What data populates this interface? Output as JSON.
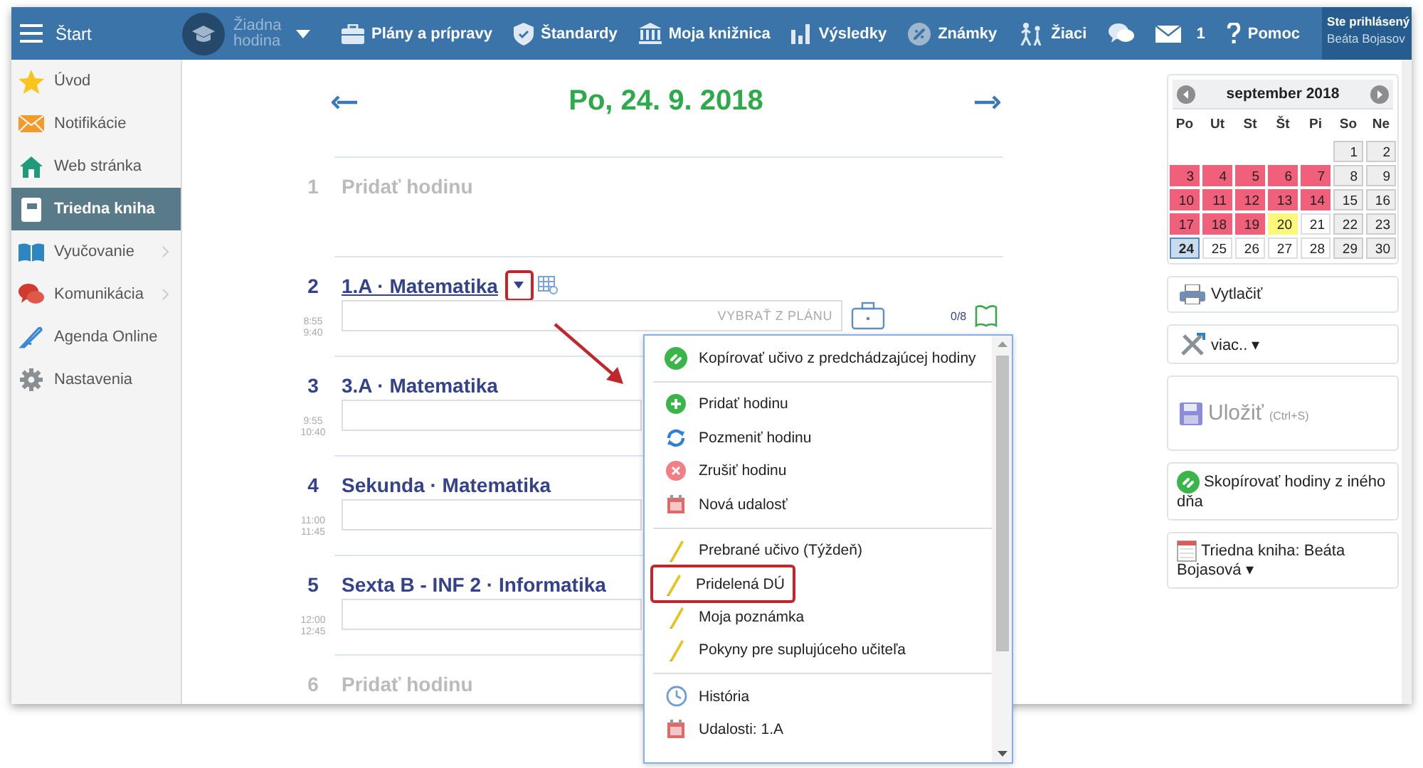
{
  "topbar": {
    "start": "Štart",
    "lesson_selector": "Žiadna hodina",
    "nav": [
      "Plány a prípravy",
      "Štandardy",
      "Moja knižnica",
      "Výsledky",
      "Známky",
      "Žiaci"
    ],
    "message_count": "1",
    "help": "Pomoc",
    "user": {
      "caption": "Ste prihlásený",
      "name": "Beáta Bojasov"
    }
  },
  "sidebar": {
    "items": [
      {
        "label": "Úvod",
        "selected": false,
        "has_submenu": false
      },
      {
        "label": "Notifikácie",
        "selected": false,
        "has_submenu": false
      },
      {
        "label": "Web stránka",
        "selected": false,
        "has_submenu": false
      },
      {
        "label": "Triedna kniha",
        "selected": true,
        "has_submenu": false
      },
      {
        "label": "Vyučovanie",
        "selected": false,
        "has_submenu": true
      },
      {
        "label": "Komunikácia",
        "selected": false,
        "has_submenu": true
      },
      {
        "label": "Agenda Online",
        "selected": false,
        "has_submenu": false
      },
      {
        "label": "Nastavenia",
        "selected": false,
        "has_submenu": false
      }
    ]
  },
  "day": {
    "title": "Po, 24. 9. 2018",
    "lessons": [
      {
        "kind": "empty",
        "number": "1",
        "title": "Pridať hodinu"
      },
      {
        "kind": "lesson",
        "number": "2",
        "title": "1.A · Matematika",
        "start": "8:55",
        "end": "9:40",
        "hovered": true,
        "annotated": true,
        "plan_button": "VYBRAŤ Z PLÁNU",
        "count": "0/8"
      },
      {
        "kind": "lesson",
        "number": "3",
        "title": "3.A · Matematika",
        "start": "9:55",
        "end": "10:40",
        "hovered": false
      },
      {
        "kind": "lesson",
        "number": "4",
        "title": "Sekunda · Matematika",
        "start": "11:00",
        "end": "11:45",
        "hovered": false
      },
      {
        "kind": "lesson",
        "number": "5",
        "title": "Sexta B - INF 2 · Informatika",
        "start": "12:00",
        "end": "12:45",
        "hovered": false
      },
      {
        "kind": "empty",
        "number": "6",
        "title": "Pridať hodinu"
      }
    ]
  },
  "context_menu": {
    "groups": [
      [
        {
          "label": "Kopírovať učivo z predchádzajúcej hodiny",
          "annotated": false
        }
      ],
      [
        {
          "label": "Pridať hodinu",
          "annotated": false
        },
        {
          "label": "Pozmeniť hodinu",
          "annotated": false
        },
        {
          "label": "Zrušiť hodinu",
          "annotated": false
        },
        {
          "label": "Nová udalosť",
          "annotated": false
        }
      ],
      [
        {
          "label": "Prebrané učivo (Týždeň)",
          "annotated": false
        },
        {
          "label": "Pridelená DÚ",
          "annotated": true
        },
        {
          "label": "Moja poznámka",
          "annotated": false
        },
        {
          "label": "Pokyny pre suplujúceho učiteľa",
          "annotated": false
        }
      ],
      [
        {
          "label": "História",
          "annotated": false
        },
        {
          "label": "Udalosti: 1.A",
          "annotated": false
        }
      ]
    ]
  },
  "calendar": {
    "title": "september 2018",
    "weekdays": [
      "Po",
      "Ut",
      "St",
      "Št",
      "Pi",
      "So",
      "Ne"
    ],
    "weeks": [
      [
        {
          "kind": "blank"
        },
        {
          "kind": "blank"
        },
        {
          "kind": "blank"
        },
        {
          "kind": "blank"
        },
        {
          "kind": "blank"
        },
        {
          "kind": "day",
          "day": "1",
          "color": "#eeeeee",
          "selected": false
        },
        {
          "kind": "day",
          "day": "2",
          "color": "#eeeeee",
          "selected": false
        }
      ],
      [
        {
          "kind": "day",
          "day": "3",
          "color": "#f0607a",
          "selected": false
        },
        {
          "kind": "day",
          "day": "4",
          "color": "#f0607a",
          "selected": false
        },
        {
          "kind": "day",
          "day": "5",
          "color": "#f0607a",
          "selected": false
        },
        {
          "kind": "day",
          "day": "6",
          "color": "#f0607a",
          "selected": false
        },
        {
          "kind": "day",
          "day": "7",
          "color": "#f0607a",
          "selected": false
        },
        {
          "kind": "day",
          "day": "8",
          "color": "#eeeeee",
          "selected": false
        },
        {
          "kind": "day",
          "day": "9",
          "color": "#eeeeee",
          "selected": false
        }
      ],
      [
        {
          "kind": "day",
          "day": "10",
          "color": "#f0607a",
          "selected": false
        },
        {
          "kind": "day",
          "day": "11",
          "color": "#f0607a",
          "selected": false
        },
        {
          "kind": "day",
          "day": "12",
          "color": "#f0607a",
          "selected": false
        },
        {
          "kind": "day",
          "day": "13",
          "color": "#f0607a",
          "selected": false
        },
        {
          "kind": "day",
          "day": "14",
          "color": "#f0607a",
          "selected": false
        },
        {
          "kind": "day",
          "day": "15",
          "color": "#eeeeee",
          "selected": false
        },
        {
          "kind": "day",
          "day": "16",
          "color": "#eeeeee",
          "selected": false
        }
      ],
      [
        {
          "kind": "day",
          "day": "17",
          "color": "#f0607a",
          "selected": false
        },
        {
          "kind": "day",
          "day": "18",
          "color": "#f0607a",
          "selected": false
        },
        {
          "kind": "day",
          "day": "19",
          "color": "#f0607a",
          "selected": false
        },
        {
          "kind": "day",
          "day": "20",
          "color": "#fdf77a",
          "selected": false
        },
        {
          "kind": "day",
          "day": "21",
          "color": "#ffffff",
          "selected": false
        },
        {
          "kind": "day",
          "day": "22",
          "color": "#eeeeee",
          "selected": false
        },
        {
          "kind": "day",
          "day": "23",
          "color": "#eeeeee",
          "selected": false
        }
      ],
      [
        {
          "kind": "day",
          "day": "24",
          "color": "#c9dbee",
          "selected": true
        },
        {
          "kind": "day",
          "day": "25",
          "color": "#ffffff",
          "selected": false
        },
        {
          "kind": "day",
          "day": "26",
          "color": "#ffffff",
          "selected": false
        },
        {
          "kind": "day",
          "day": "27",
          "color": "#ffffff",
          "selected": false
        },
        {
          "kind": "day",
          "day": "28",
          "color": "#ffffff",
          "selected": false
        },
        {
          "kind": "day",
          "day": "29",
          "color": "#eeeeee",
          "selected": false
        },
        {
          "kind": "day",
          "day": "30",
          "color": "#eeeeee",
          "selected": false
        }
      ]
    ]
  },
  "actions": [
    {
      "label": "Vytlačiť",
      "disabled": false
    },
    {
      "label": "viac.. ▾",
      "disabled": false
    },
    {
      "label": "Uložiť",
      "hint": "(Ctrl+S)",
      "disabled": true
    },
    {
      "label": "Skopírovať hodiny z iného dňa",
      "disabled": false
    },
    {
      "label": "Triedna kniha: Beáta Bojasová ▾",
      "disabled": false
    }
  ]
}
